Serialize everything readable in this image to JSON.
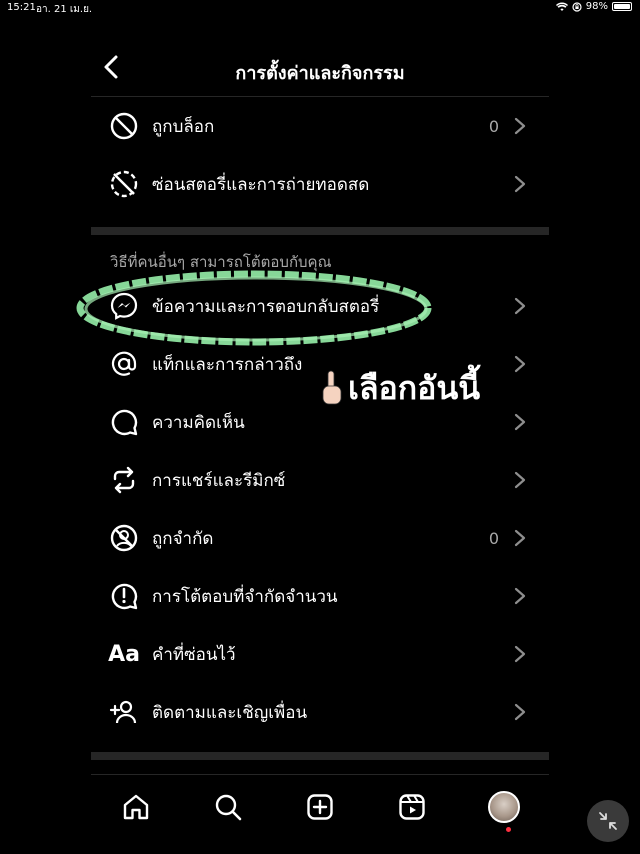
{
  "status_bar": {
    "time": "15:21",
    "date": "อา. 21 เม.ย.",
    "battery": "98%",
    "battery_level": 0.98
  },
  "header": {
    "title": "การตั้งค่าและกิจกรรม"
  },
  "top_items": [
    {
      "label": "ถูกบล็อก",
      "count": "0",
      "icon": "block-icon"
    },
    {
      "label": "ซ่อนสตอรี่และการถ่ายทอดสด",
      "count": "",
      "icon": "hide-story-icon"
    }
  ],
  "section": {
    "title": "วิธีที่คนอื่นๆ สามารถโต้ตอบกับคุณ",
    "items": [
      {
        "label": "ข้อความและการตอบกลับสตอรี่",
        "count": "",
        "icon": "messenger-icon"
      },
      {
        "label": "แท็กและการกล่าวถึง",
        "count": "",
        "icon": "at-sign-icon"
      },
      {
        "label": "ความคิดเห็น",
        "count": "",
        "icon": "comment-icon"
      },
      {
        "label": "การแชร์และรีมิกซ์",
        "count": "",
        "icon": "share-remix-icon"
      },
      {
        "label": "ถูกจำกัด",
        "count": "0",
        "icon": "restricted-icon"
      },
      {
        "label": "การโต้ตอบที่จำกัดจำนวน",
        "count": "",
        "icon": "limited-interactions-icon"
      },
      {
        "label": "คำที่ซ่อนไว้",
        "count": "",
        "icon": "hidden-words-icon"
      },
      {
        "label": "ติดตามและเชิญเพื่อน",
        "count": "",
        "icon": "add-friend-icon"
      }
    ]
  },
  "annotation": {
    "text": "เลือกอันนี้",
    "hidden_words_icon_text": "Aa"
  },
  "tabbar": {
    "items": [
      "home-icon",
      "search-icon",
      "create-icon",
      "reels-icon",
      "profile-avatar"
    ]
  },
  "colors": {
    "background": "#000000",
    "divider": "#262626",
    "secondary_text": "#a8a8a8",
    "highlight": "#8ee3a0",
    "notification": "#ff3040"
  }
}
